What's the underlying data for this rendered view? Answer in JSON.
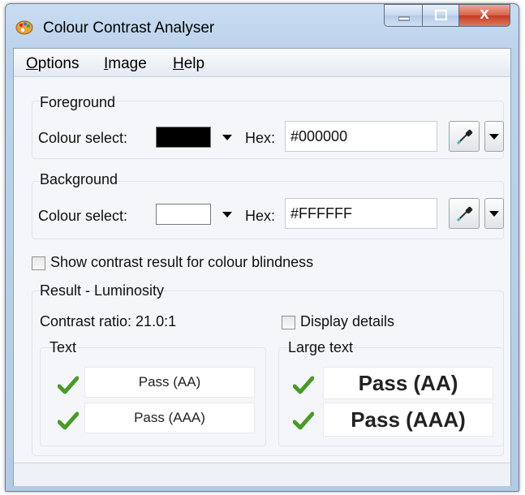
{
  "window": {
    "title": "Colour Contrast Analyser",
    "close_glyph": "x"
  },
  "menu": {
    "options": "Options",
    "image": "Image",
    "help": "Help"
  },
  "foreground": {
    "group_label": "Foreground",
    "colour_select_label": "Colour select:",
    "swatch_color": "#000000",
    "hex_label": "Hex:",
    "hex_value": "#000000"
  },
  "background": {
    "group_label": "Background",
    "colour_select_label": "Colour select:",
    "swatch_color": "#FFFFFF",
    "hex_label": "Hex:",
    "hex_value": "#FFFFFF"
  },
  "colour_blindness": {
    "label": "Show contrast result for colour blindness",
    "checked": false
  },
  "result": {
    "group_label": "Result - Luminosity",
    "contrast_ratio": "Contrast ratio: 21.0:1",
    "display_details_label": "Display details",
    "text": {
      "label": "Text",
      "aa": "Pass (AA)",
      "aaa": "Pass (AAA)"
    },
    "large_text": {
      "label": "Large text",
      "aa": "Pass (AA)",
      "aaa": "Pass (AAA)"
    }
  },
  "colors": {
    "pass_check": "#4a9a2a",
    "accent": "#1f5fa8"
  },
  "icons": [
    "app-palette-icon",
    "minimize-icon",
    "maximize-icon",
    "close-icon",
    "eyedropper-icon",
    "chevron-down-icon",
    "checkmark-icon"
  ]
}
